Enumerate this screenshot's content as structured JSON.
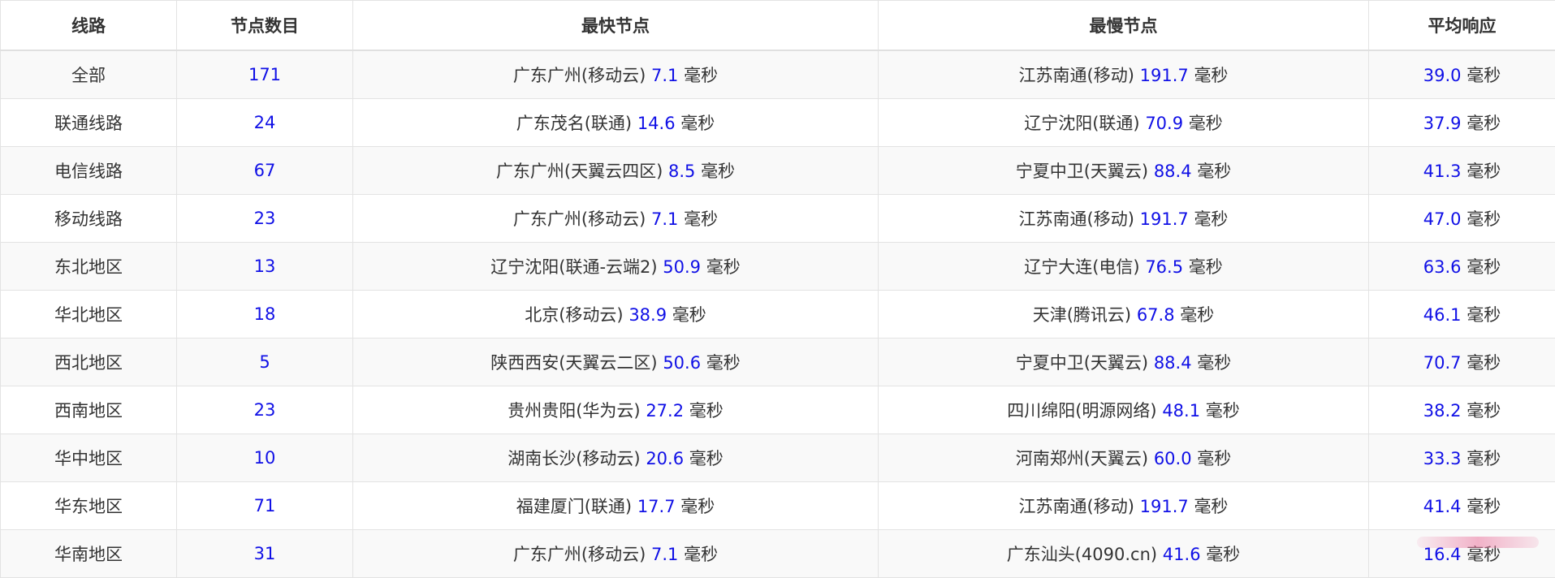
{
  "table": {
    "headers": [
      "线路",
      "节点数目",
      "最快节点",
      "最慢节点",
      "平均响应"
    ],
    "unit": "毫秒",
    "rows": [
      {
        "route": "全部",
        "count": "171",
        "fast_node": "广东广州(移动云)",
        "fast_ms": "7.1",
        "slow_node": "江苏南通(移动)",
        "slow_ms": "191.7",
        "avg_ms": "39.0"
      },
      {
        "route": "联通线路",
        "count": "24",
        "fast_node": "广东茂名(联通)",
        "fast_ms": "14.6",
        "slow_node": "辽宁沈阳(联通)",
        "slow_ms": "70.9",
        "avg_ms": "37.9"
      },
      {
        "route": "电信线路",
        "count": "67",
        "fast_node": "广东广州(天翼云四区)",
        "fast_ms": "8.5",
        "slow_node": "宁夏中卫(天翼云)",
        "slow_ms": "88.4",
        "avg_ms": "41.3"
      },
      {
        "route": "移动线路",
        "count": "23",
        "fast_node": "广东广州(移动云)",
        "fast_ms": "7.1",
        "slow_node": "江苏南通(移动)",
        "slow_ms": "191.7",
        "avg_ms": "47.0"
      },
      {
        "route": "东北地区",
        "count": "13",
        "fast_node": "辽宁沈阳(联通-云端2)",
        "fast_ms": "50.9",
        "slow_node": "辽宁大连(电信)",
        "slow_ms": "76.5",
        "avg_ms": "63.6"
      },
      {
        "route": "华北地区",
        "count": "18",
        "fast_node": "北京(移动云)",
        "fast_ms": "38.9",
        "slow_node": "天津(腾讯云)",
        "slow_ms": "67.8",
        "avg_ms": "46.1"
      },
      {
        "route": "西北地区",
        "count": "5",
        "fast_node": "陕西西安(天翼云二区)",
        "fast_ms": "50.6",
        "slow_node": "宁夏中卫(天翼云)",
        "slow_ms": "88.4",
        "avg_ms": "70.7"
      },
      {
        "route": "西南地区",
        "count": "23",
        "fast_node": "贵州贵阳(华为云)",
        "fast_ms": "27.2",
        "slow_node": "四川绵阳(明源网络)",
        "slow_ms": "48.1",
        "avg_ms": "38.2"
      },
      {
        "route": "华中地区",
        "count": "10",
        "fast_node": "湖南长沙(移动云)",
        "fast_ms": "20.6",
        "slow_node": "河南郑州(天翼云)",
        "slow_ms": "60.0",
        "avg_ms": "33.3"
      },
      {
        "route": "华东地区",
        "count": "71",
        "fast_node": "福建厦门(联通)",
        "fast_ms": "17.7",
        "slow_node": "江苏南通(移动)",
        "slow_ms": "191.7",
        "avg_ms": "41.4"
      },
      {
        "route": "华南地区",
        "count": "31",
        "fast_node": "广东广州(移动云)",
        "fast_ms": "7.1",
        "slow_node": "广东汕头(4090.cn)",
        "slow_ms": "41.6",
        "avg_ms": "16.4"
      }
    ]
  }
}
